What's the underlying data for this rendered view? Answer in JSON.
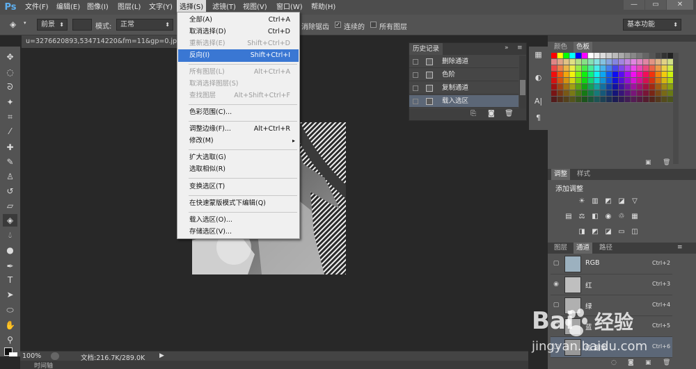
{
  "app": {
    "logo": "Ps"
  },
  "menubar": {
    "items": [
      "文件(F)",
      "编辑(E)",
      "图像(I)",
      "图层(L)",
      "文字(Y)",
      "选择(S)",
      "滤镜(T)",
      "视图(V)",
      "窗口(W)",
      "帮助(H)"
    ],
    "active_index": 5,
    "win_min": "—",
    "win_max": "▭",
    "win_close": "✕"
  },
  "options": {
    "foreground_label": "前景",
    "mode_label": "模式:",
    "mode_value": "正常",
    "antialias_label": "消除锯齿",
    "contiguous_label": "连续的",
    "all_layers_label": "所有图层",
    "workspace": "基本功能"
  },
  "document": {
    "tab_title": "u=3276620893,534714220&fm=11&gp=0.jpg @"
  },
  "statusbar": {
    "zoom": "100%",
    "doc_info": "文档:216.7K/289.0K",
    "timeline": "时间轴"
  },
  "select_menu": {
    "items": [
      {
        "label": "全部(A)",
        "shortcut": "Ctrl+A",
        "disabled": false
      },
      {
        "label": "取消选择(D)",
        "shortcut": "Ctrl+D",
        "disabled": false
      },
      {
        "label": "重新选择(E)",
        "shortcut": "Shift+Ctrl+D",
        "disabled": true
      },
      {
        "label": "反向(I)",
        "shortcut": "Shift+Ctrl+I",
        "disabled": false,
        "highlighted": true
      },
      {
        "label": "所有图层(L)",
        "shortcut": "Alt+Ctrl+A",
        "disabled": true
      },
      {
        "label": "取消选择图层(S)",
        "shortcut": "",
        "disabled": true
      },
      {
        "label": "查找图层",
        "shortcut": "Alt+Shift+Ctrl+F",
        "disabled": true
      },
      {
        "label": "色彩范围(C)...",
        "shortcut": "",
        "disabled": false
      },
      {
        "label": "调整边缘(F)...",
        "shortcut": "Alt+Ctrl+R",
        "disabled": false
      },
      {
        "label": "修改(M)",
        "shortcut": "",
        "disabled": false,
        "submenu": true
      },
      {
        "label": "扩大选取(G)",
        "shortcut": "",
        "disabled": false
      },
      {
        "label": "选取相似(R)",
        "shortcut": "",
        "disabled": false
      },
      {
        "label": "变换选区(T)",
        "shortcut": "",
        "disabled": false
      },
      {
        "label": "在快速蒙版模式下编辑(Q)",
        "shortcut": "",
        "disabled": false
      },
      {
        "label": "载入选区(O)...",
        "shortcut": "",
        "disabled": false
      },
      {
        "label": "存储选区(V)...",
        "shortcut": "",
        "disabled": false
      }
    ]
  },
  "history": {
    "tab": "历史记录",
    "items": [
      "删除通道",
      "色阶",
      "复制通道",
      "载入选区"
    ],
    "selected_index": 3
  },
  "swatches": {
    "tab_color": "颜色",
    "tab_swatches": "色板"
  },
  "adjustments": {
    "tab_adjust": "调整",
    "tab_style": "样式",
    "title": "添加调整"
  },
  "channels": {
    "tab_layers": "图层",
    "tab_channels": "通道",
    "tab_paths": "路径",
    "rows": [
      {
        "name": "RGB",
        "shortcut": "Ctrl+2",
        "visible": false
      },
      {
        "name": "红",
        "shortcut": "Ctrl+3",
        "visible": true
      },
      {
        "name": "绿",
        "shortcut": "Ctrl+4",
        "visible": false
      },
      {
        "name": "蓝",
        "shortcut": "Ctrl+5",
        "visible": false
      },
      {
        "name": "红 副本",
        "shortcut": "Ctrl+6",
        "visible": false
      }
    ]
  },
  "watermark": {
    "brand": "Bai",
    "brand2": "经验",
    "url": "jingyan.baidu.com"
  },
  "colors": {
    "menu_highlight": "#3a77d3",
    "panel": "#535353",
    "canvas_bg": "#282828"
  }
}
